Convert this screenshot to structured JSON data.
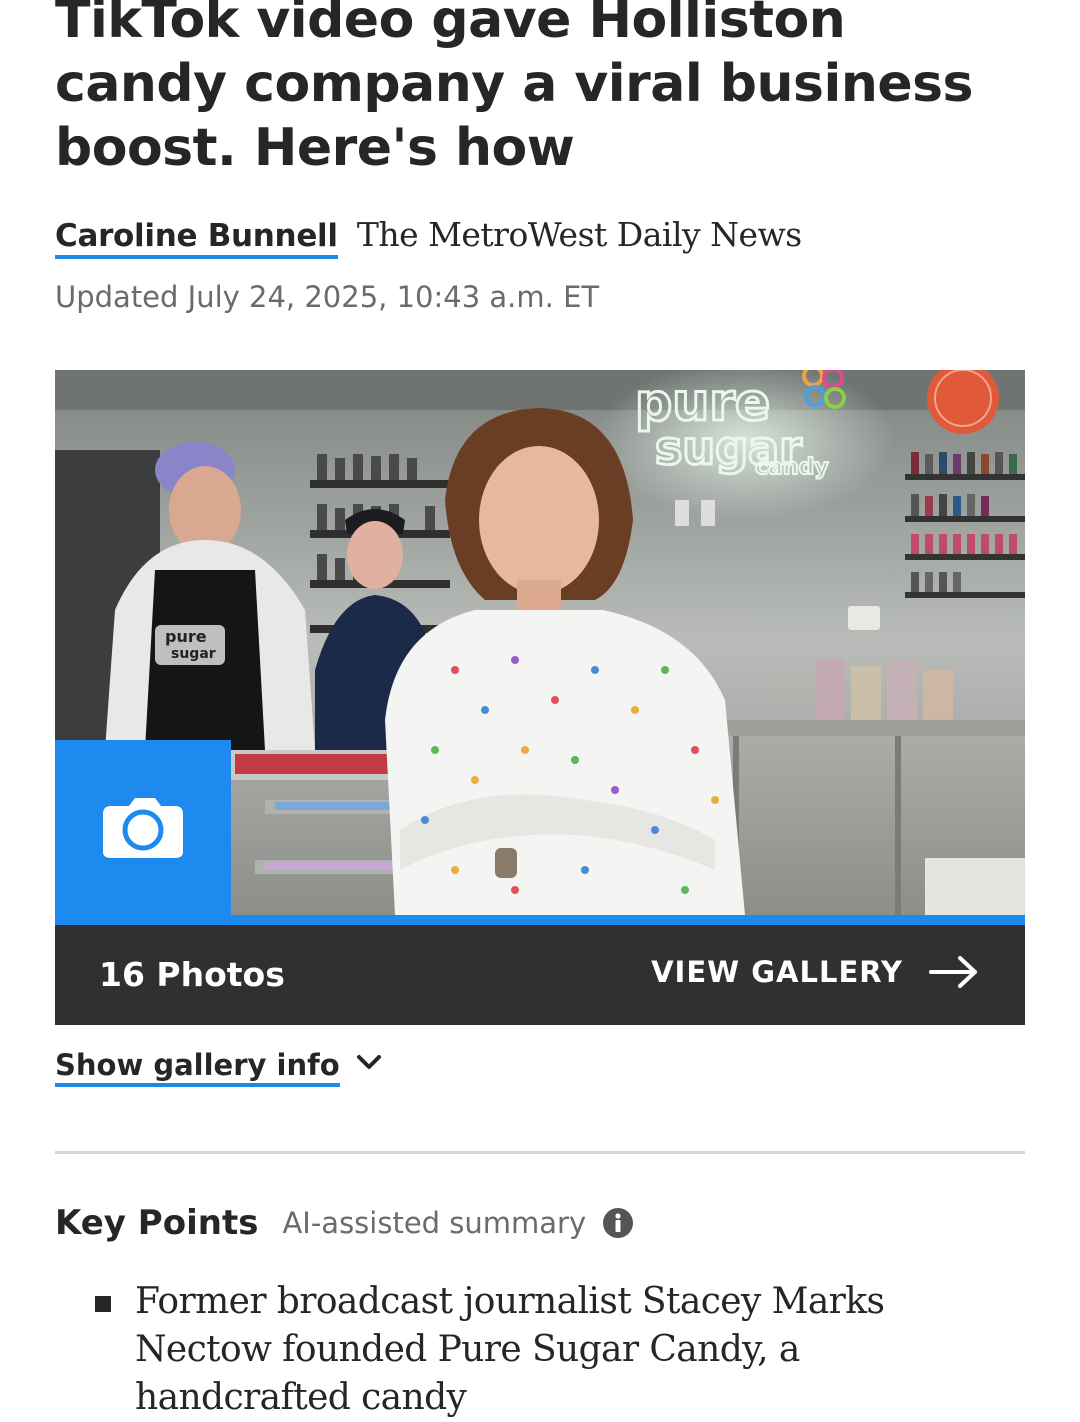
{
  "article": {
    "headline": "TikTok video gave Holliston candy company a viral business boost. Here's how",
    "author": "Caroline Bunnell",
    "publication": "The MetroWest Daily News",
    "updated": "Updated July 24, 2025, 10:43 a.m. ET"
  },
  "gallery": {
    "photo_count": "16 Photos",
    "view_label": "VIEW GALLERY",
    "info_toggle": "Show gallery info",
    "signage": {
      "line1": "pure",
      "line2": "sugar",
      "line3": "candy"
    },
    "apron_text": {
      "line1": "pure",
      "line2": "sugar"
    }
  },
  "key_points": {
    "title": "Key Points",
    "subtitle": "AI-assisted summary",
    "items": [
      "Former broadcast journalist Stacey Marks Nectow founded Pure Sugar Candy, a handcrafted candy"
    ]
  },
  "colors": {
    "accent": "#1e88e5",
    "gallery_bar": "#303030",
    "text": "#262626",
    "muted": "#6b6b6b"
  }
}
